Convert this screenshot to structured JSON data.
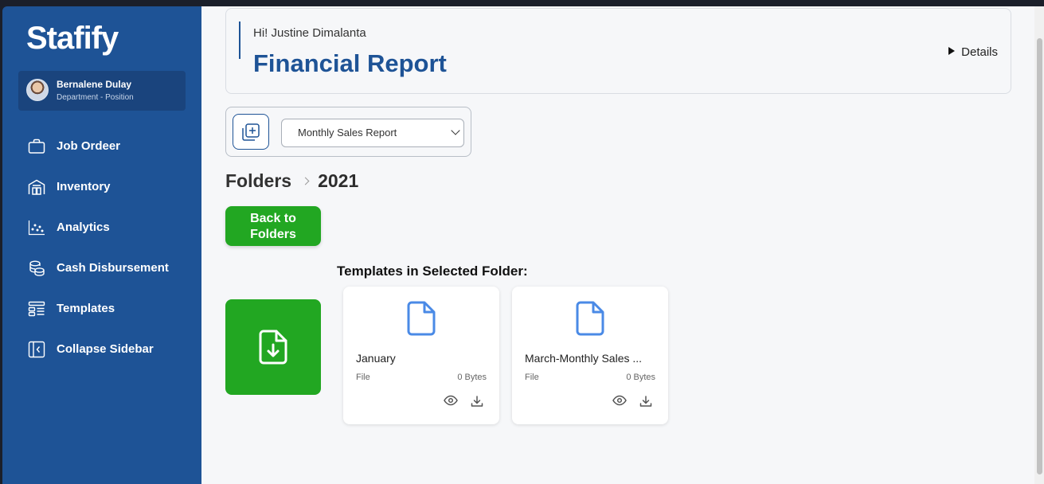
{
  "app": {
    "logo": "Stafify"
  },
  "user": {
    "name": "Bernalene Dulay",
    "role": "Department - Position"
  },
  "sidebar": {
    "items": [
      {
        "label": "Job Ordeer",
        "icon": "briefcase-icon"
      },
      {
        "label": "Inventory",
        "icon": "warehouse-icon"
      },
      {
        "label": "Analytics",
        "icon": "scatter-chart-icon"
      },
      {
        "label": "Cash Disbursement",
        "icon": "coins-icon"
      },
      {
        "label": "Templates",
        "icon": "template-layout-icon"
      },
      {
        "label": "Collapse Sidebar",
        "icon": "collapse-sidebar-icon"
      }
    ]
  },
  "header": {
    "greeting": "Hi! Justine Dimalanta",
    "title": "Financial Report",
    "details_label": "Details"
  },
  "toolbar": {
    "new_icon": "add-copy-icon",
    "selected_report": "Monthly Sales Report"
  },
  "breadcrumb": {
    "root": "Folders",
    "current": "2021"
  },
  "back_button": {
    "label": "Back to Folders"
  },
  "upload": {
    "icon": "file-download-icon"
  },
  "templates": {
    "heading": "Templates in Selected Folder:",
    "files": [
      {
        "name": "January",
        "type": "File",
        "size": "0 Bytes"
      },
      {
        "name": "March-Monthly Sales ...",
        "type": "File",
        "size": "0 Bytes"
      }
    ]
  },
  "colors": {
    "sidebar_bg": "#1e5396",
    "accent_blue": "#1e5396",
    "file_icon_blue": "#4a8ae6",
    "green": "#22a722"
  }
}
